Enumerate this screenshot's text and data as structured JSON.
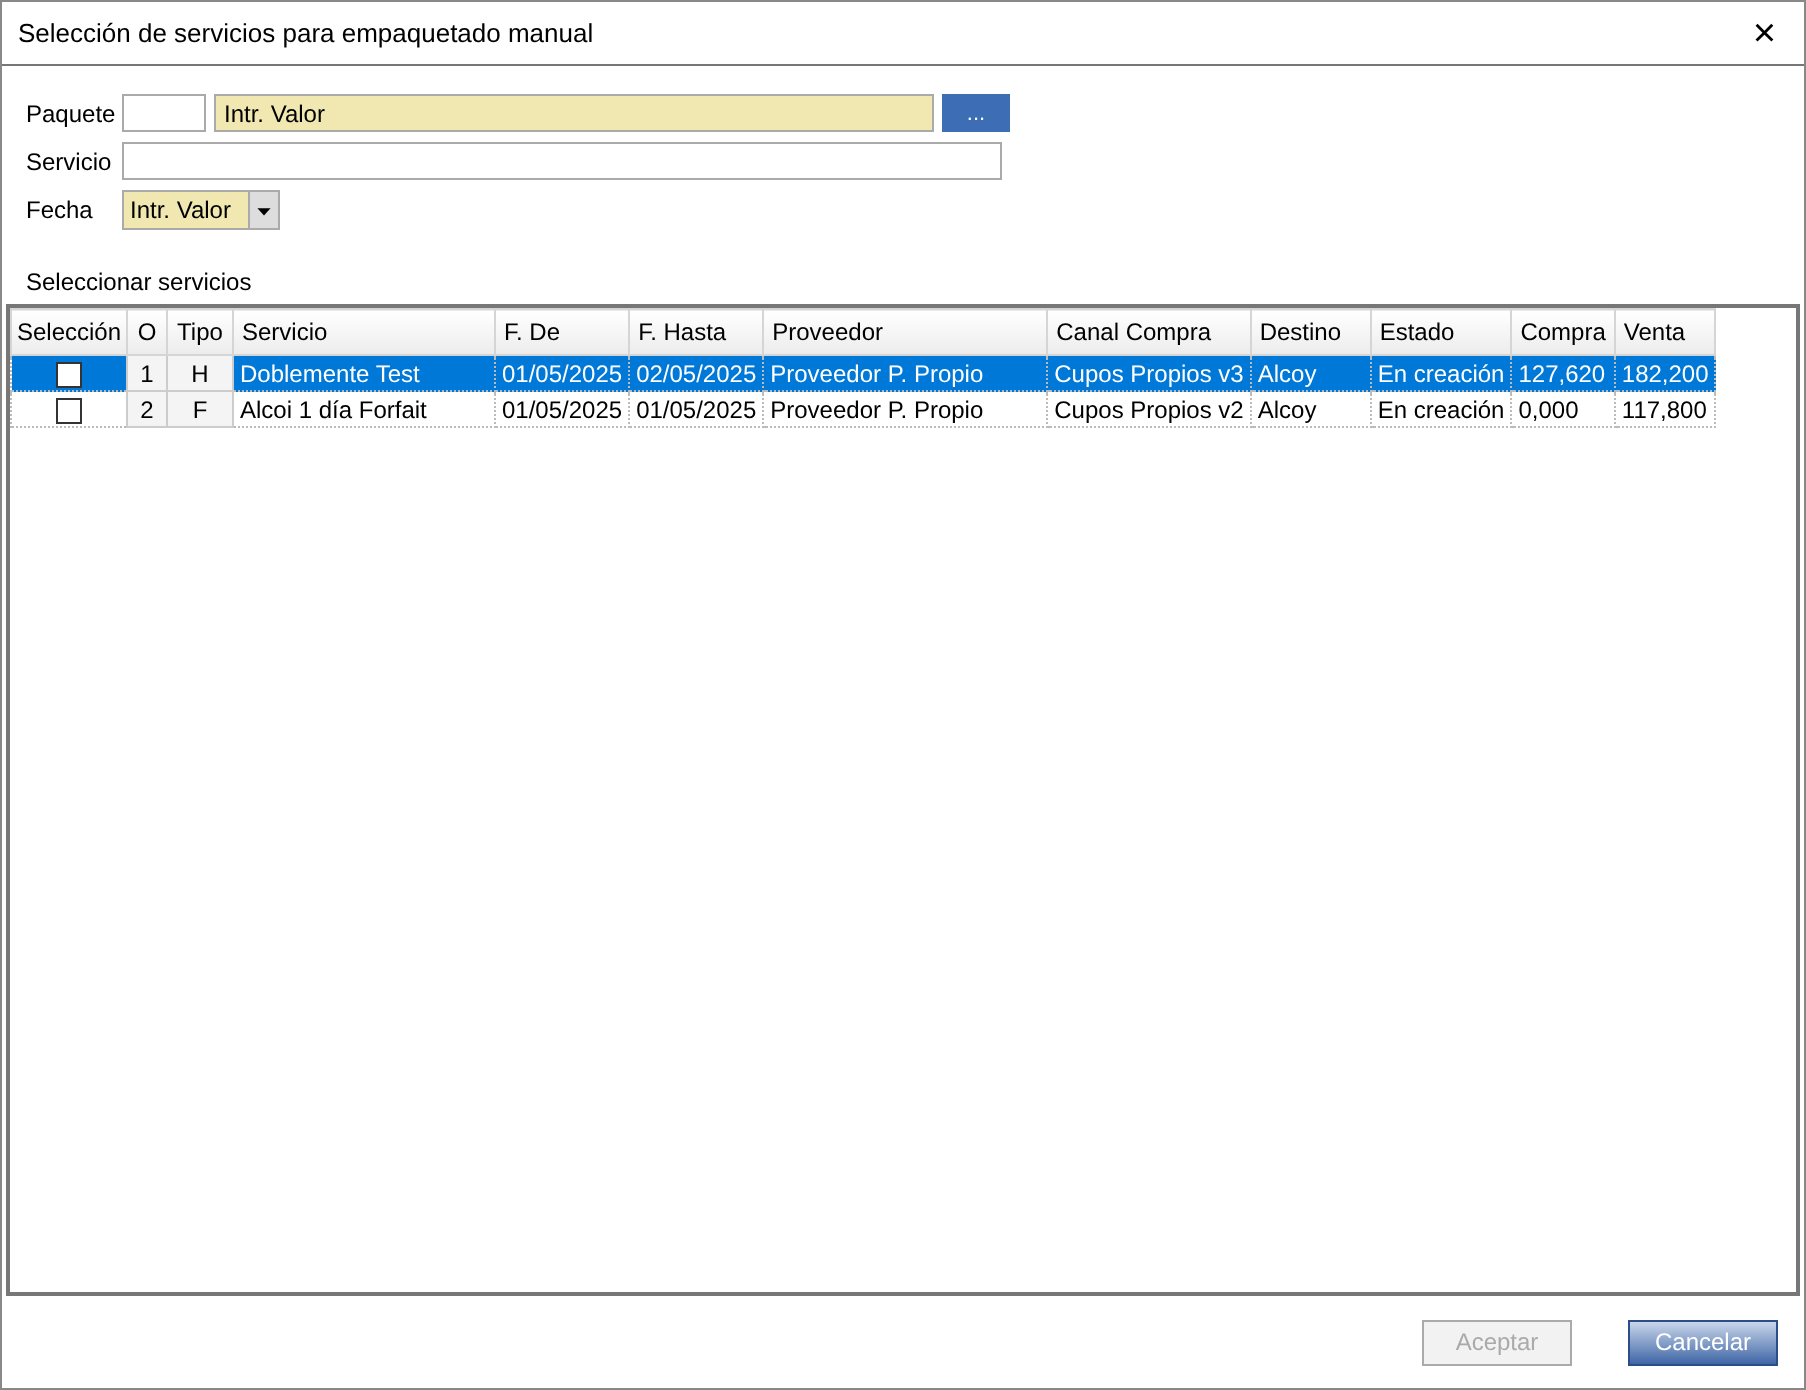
{
  "window": {
    "title": "Selección de servicios para empaquetado manual",
    "close": "×"
  },
  "form": {
    "paquete": {
      "label": "Paquete",
      "name": "Intr. Valor",
      "button": "..."
    },
    "servicio": {
      "label": "Servicio"
    },
    "fecha": {
      "label": "Fecha",
      "value": "Intr. Valor"
    }
  },
  "grid": {
    "title": "Seleccionar servicios",
    "columns": [
      "Selección",
      "O",
      "Tipo",
      "Servicio",
      "F. De",
      "F. Hasta",
      "Proveedor",
      "Canal Compra",
      "Destino",
      "Estado",
      "Compra",
      "Venta"
    ],
    "rows": [
      {
        "selected": true,
        "checked": false,
        "cells": [
          null,
          "1",
          "H",
          "Doblemente Test",
          "01/05/2025",
          "02/05/2025",
          "Proveedor P. Propio",
          "Cupos Propios v3",
          "Alcoy",
          "En creación",
          "127,620",
          "182,200"
        ]
      },
      {
        "selected": false,
        "checked": false,
        "cells": [
          null,
          "2",
          "F",
          "Alcoi 1 día Forfait",
          "01/05/2025",
          "01/05/2025",
          "Proveedor P. Propio",
          "Cupos Propios v2",
          "Alcoy",
          "En creación",
          "0,000",
          "117,800"
        ]
      }
    ]
  },
  "buttons": [
    {
      "label": "Aceptar",
      "disabled": true
    },
    {
      "label": "Cancelar",
      "disabled": false
    }
  ]
}
